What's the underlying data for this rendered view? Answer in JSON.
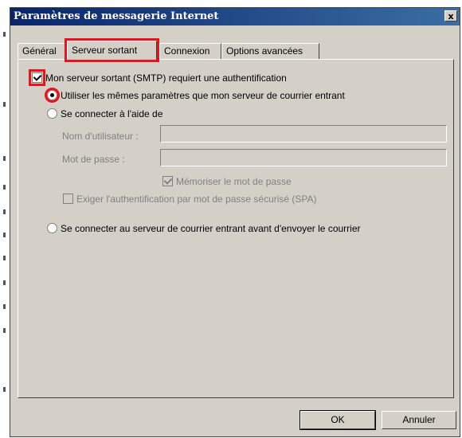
{
  "dialog": {
    "title": "Paramètres de messagerie Internet",
    "close_label": "x"
  },
  "tabs": [
    {
      "label": "Général",
      "active": false
    },
    {
      "label": "Serveur sortant",
      "active": true
    },
    {
      "label": "Connexion",
      "active": false
    },
    {
      "label": "Options avancées",
      "active": false
    }
  ],
  "smtp_auth": {
    "label": "Mon serveur sortant (SMTP) requiert une authentification",
    "checked": true
  },
  "auth_options": {
    "same_settings": {
      "label": "Utiliser les mêmes paramètres que mon serveur de courrier entrant",
      "selected": true
    },
    "log_on_using": {
      "label": "Se connecter à l'aide de",
      "selected": false
    },
    "username": {
      "label": "Nom d'utilisateur :",
      "value": ""
    },
    "password": {
      "label": "Mot de passe :",
      "value": ""
    },
    "remember_password": {
      "label": "Mémoriser le mot de passe",
      "checked": true,
      "enabled": false
    },
    "spa": {
      "label": "Exiger l'authentification par mot de passe sécurisé (SPA)",
      "checked": false,
      "enabled": false
    },
    "log_on_incoming_first": {
      "label": "Se connecter au serveur de courrier entrant avant d'envoyer le courrier",
      "selected": false
    }
  },
  "buttons": {
    "ok": "OK",
    "cancel": "Annuler"
  },
  "colors": {
    "highlight": "#e8141b",
    "dialog_bg": "#d4d0c8",
    "titlebar_start": "#0a246a",
    "titlebar_end": "#3a6ea5"
  }
}
